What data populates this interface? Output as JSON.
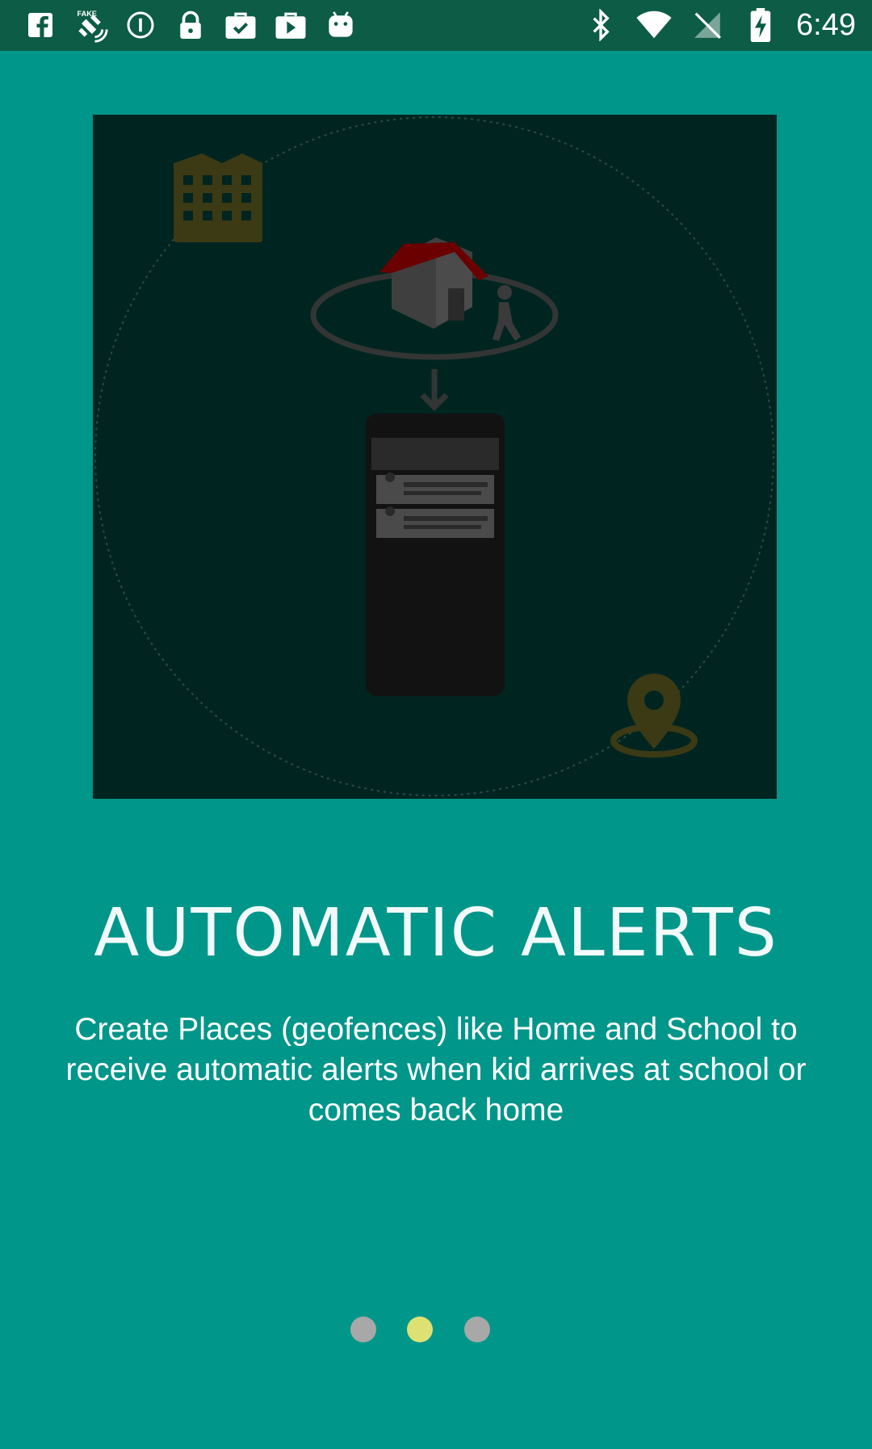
{
  "status_bar": {
    "time": "6:49",
    "left_icons": [
      "facebook-icon",
      "fake-gps-icon",
      "info-circle-icon",
      "lock-icon",
      "briefcase-check-icon",
      "youtube-icon",
      "android-icon"
    ],
    "right_icons": [
      "bluetooth-icon",
      "wifi-icon",
      "no-sim-icon",
      "battery-charging-icon"
    ]
  },
  "onboarding": {
    "title": "AUTOMATIC ALERTS",
    "description": "Create Places (geofences) like Home and School to receive automatic alerts when kid arrives at school or comes back home",
    "page_indicator": {
      "count": 3,
      "active_index": 1,
      "active_color": "#dde073",
      "inactive_color": "#a8a8a8"
    }
  },
  "colors": {
    "background": "#00968a",
    "status_bar": "#0d5c45",
    "illustration_bg": "#002520"
  }
}
